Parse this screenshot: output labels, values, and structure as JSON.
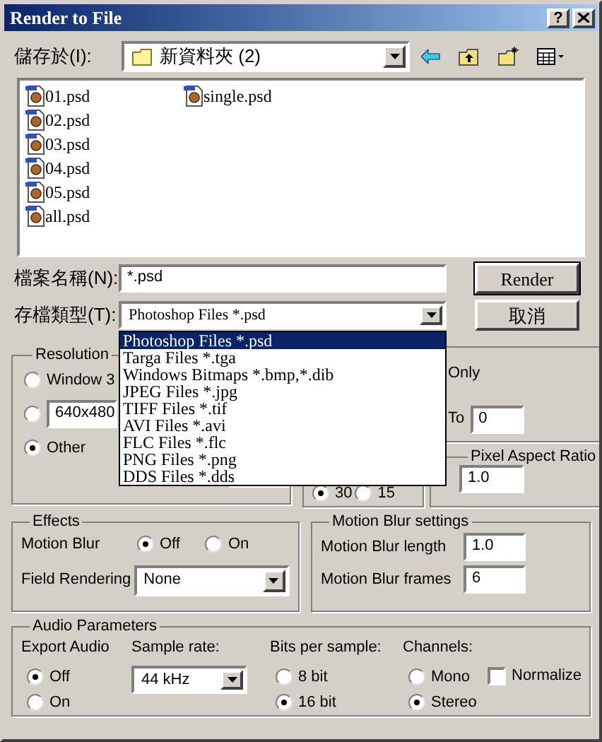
{
  "window": {
    "title": "Render to File",
    "help_button": "?"
  },
  "save_in": {
    "label": "儲存於(I):",
    "folder": "新資料夾 (2)"
  },
  "file_columns": [
    [
      {
        "name": "01.psd"
      },
      {
        "name": "02.psd"
      },
      {
        "name": "03.psd"
      },
      {
        "name": "04.psd"
      },
      {
        "name": "05.psd"
      },
      {
        "name": "all.psd"
      }
    ],
    [
      {
        "name": "single.psd"
      }
    ]
  ],
  "filename": {
    "label": "檔案名稱(N):",
    "value": "*.psd"
  },
  "filetype": {
    "label": "存檔類型(T):",
    "value": "Photoshop Files *.psd",
    "expanded": true,
    "options": [
      {
        "label": "Photoshop Files *.psd",
        "selected": true
      },
      {
        "label": "Targa Files *.tga",
        "selected": false
      },
      {
        "label": "Windows Bitmaps *.bmp,*.dib",
        "selected": false
      },
      {
        "label": "JPEG Files *.jpg",
        "selected": false
      },
      {
        "label": "TIFF Files *.tif",
        "selected": false
      },
      {
        "label": "AVI Files *.avi",
        "selected": false
      },
      {
        "label": "FLC Files *.flc",
        "selected": false
      },
      {
        "label": "PNG Files *.png",
        "selected": false
      },
      {
        "label": "DDS Files *.dds",
        "selected": false
      }
    ]
  },
  "buttons": [
    "Render",
    "取消"
  ],
  "resolution": {
    "title": "Resolution",
    "options": [
      {
        "kind": "text",
        "label": "Window 3",
        "selected": false
      },
      {
        "kind": "field",
        "value": "640x480",
        "selected": false
      },
      {
        "kind": "text",
        "label": "Other",
        "selected": true
      }
    ]
  },
  "time_output": {
    "only_label": "Only",
    "to_label": "To",
    "to_value": "0"
  },
  "frame_rate": {
    "options": [
      {
        "label": "30",
        "selected": true
      },
      {
        "label": "15",
        "selected": false
      }
    ]
  },
  "pixel_aspect": {
    "title": "Pixel Aspect Ratio",
    "value": "1.0"
  },
  "effects": {
    "title": "Effects",
    "motion_blur": {
      "label": "Motion Blur",
      "options": [
        {
          "label": "Off",
          "selected": true
        },
        {
          "label": "On",
          "selected": false
        }
      ]
    },
    "field_rendering": {
      "label": "Field Rendering",
      "value": "None"
    }
  },
  "motion_blur_settings": {
    "title": "Motion Blur settings",
    "fields": [
      {
        "label": "Motion Blur length",
        "value": "1.0"
      },
      {
        "label": "Motion Blur frames",
        "value": "6"
      }
    ]
  },
  "audio": {
    "title": "Audio Parameters",
    "export": {
      "label": "Export Audio",
      "options": [
        {
          "label": "Off",
          "selected": true
        },
        {
          "label": "On",
          "selected": false
        }
      ]
    },
    "sample_rate": {
      "label": "Sample rate:",
      "value": "44 kHz"
    },
    "bits": {
      "label": "Bits per sample:",
      "options": [
        {
          "label": "8 bit",
          "selected": false
        },
        {
          "label": "16 bit",
          "selected": true
        }
      ]
    },
    "channels": {
      "label": "Channels:",
      "options": [
        {
          "label": "Mono",
          "selected": false
        },
        {
          "label": "Stereo",
          "selected": true
        }
      ]
    },
    "normalize": {
      "label": "Normalize",
      "checked": false
    }
  }
}
